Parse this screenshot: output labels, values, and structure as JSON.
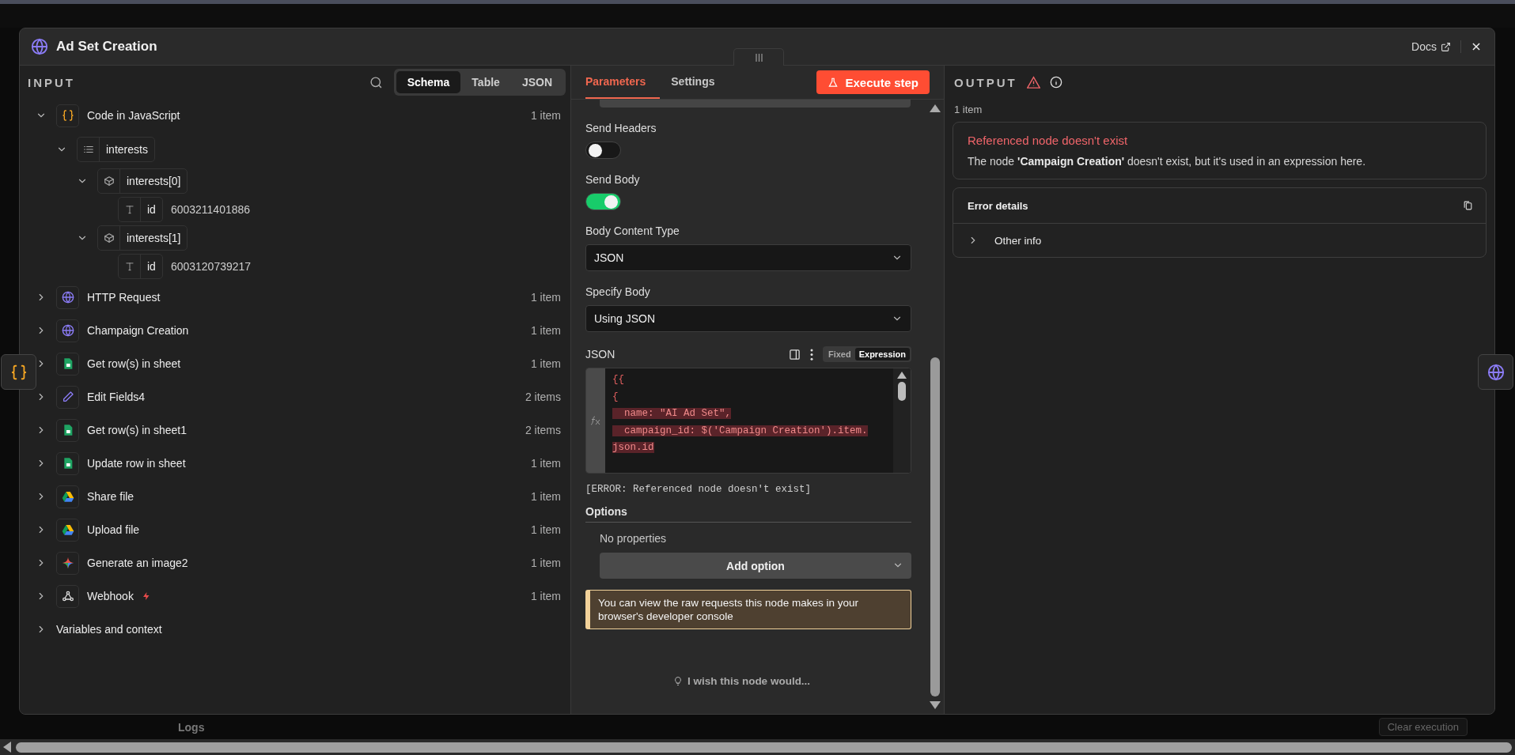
{
  "window": {
    "title": "Ad Set Creation",
    "docs_link": "Docs"
  },
  "input": {
    "title": "INPUT",
    "view_tabs": [
      {
        "label": "Schema",
        "selected": true
      },
      {
        "label": "Table",
        "selected": false
      },
      {
        "label": "JSON",
        "selected": false
      }
    ],
    "tree": [
      {
        "kind": "code",
        "name": "Code in JavaScript",
        "count": "1 item",
        "expanded": true,
        "children": [
          {
            "kind": "array",
            "name": "interests",
            "expanded": true,
            "children": [
              {
                "kind": "object",
                "name": "interests[0]",
                "expanded": true,
                "children": [
                  {
                    "kind": "string",
                    "name": "id",
                    "value": "6003211401886"
                  }
                ]
              },
              {
                "kind": "object",
                "name": "interests[1]",
                "expanded": true,
                "children": [
                  {
                    "kind": "string",
                    "name": "id",
                    "value": "6003120739217"
                  }
                ]
              }
            ]
          }
        ]
      },
      {
        "kind": "http",
        "name": "HTTP Request",
        "count": "1 item",
        "expanded": false
      },
      {
        "kind": "http",
        "name": "Champaign Creation",
        "count": "1 item",
        "expanded": false
      },
      {
        "kind": "sheets",
        "name": "Get row(s) in sheet",
        "count": "1 item",
        "expanded": false
      },
      {
        "kind": "edit",
        "name": "Edit Fields4",
        "count": "2 items",
        "expanded": false
      },
      {
        "kind": "sheets",
        "name": "Get row(s) in sheet1",
        "count": "2 items",
        "expanded": false
      },
      {
        "kind": "sheets",
        "name": "Update row in sheet",
        "count": "1 item",
        "expanded": false
      },
      {
        "kind": "drive",
        "name": "Share file",
        "count": "1 item",
        "expanded": false
      },
      {
        "kind": "drive",
        "name": "Upload file",
        "count": "1 item",
        "expanded": false
      },
      {
        "kind": "gemini",
        "name": "Generate an image2",
        "count": "1 item",
        "expanded": false
      },
      {
        "kind": "webhook",
        "name": "Webhook",
        "count": "1 item",
        "expanded": false,
        "trigger": true
      },
      {
        "kind": "group",
        "name": "Variables and context",
        "expanded": false
      }
    ]
  },
  "parameters": {
    "tabs": [
      {
        "label": "Parameters",
        "selected": true
      },
      {
        "label": "Settings",
        "selected": false
      }
    ],
    "execute_button": "Execute step",
    "fields": [
      {
        "kind": "toggle",
        "label": "Send Headers",
        "on": false
      },
      {
        "kind": "toggle",
        "label": "Send Body",
        "on": true
      },
      {
        "kind": "select",
        "label": "Body Content Type",
        "value": "JSON"
      },
      {
        "kind": "select",
        "label": "Specify Body",
        "value": "Using JSON"
      },
      {
        "kind": "code",
        "label": "JSON",
        "modes": [
          {
            "label": "Fixed",
            "selected": false
          },
          {
            "label": "Expression",
            "selected": true
          }
        ],
        "lines": [
          {
            "text": "{{",
            "highlighted": false
          },
          {
            "text": "{",
            "highlighted": false
          },
          {
            "text": "  name: \"AI Ad Set\",\n",
            "highlighted": true
          },
          {
            "text": "  campaign_id: $('Campaign Creation').item.",
            "highlighted": true
          },
          {
            "text": "json.id",
            "highlighted": true
          }
        ],
        "result": "[ERROR: Referenced node doesn't exist]"
      }
    ],
    "options": {
      "title": "Options",
      "empty": "No properties",
      "add_button": "Add option"
    },
    "notice": "You can view the raw requests this node makes in your browser's developer console",
    "feedback": "I wish this node would..."
  },
  "output": {
    "title": "OUTPUT",
    "count": "1 item",
    "error": {
      "title": "Referenced node doesn't exist",
      "message": "The node **'Campaign Creation'** doesn't exist, but it's used in an expression here."
    },
    "details": {
      "title": "Error details",
      "rows": [
        {
          "label": "Other info",
          "expanded": false
        }
      ]
    }
  },
  "background": {
    "logs": "Logs",
    "clear_button": "Clear execution"
  }
}
